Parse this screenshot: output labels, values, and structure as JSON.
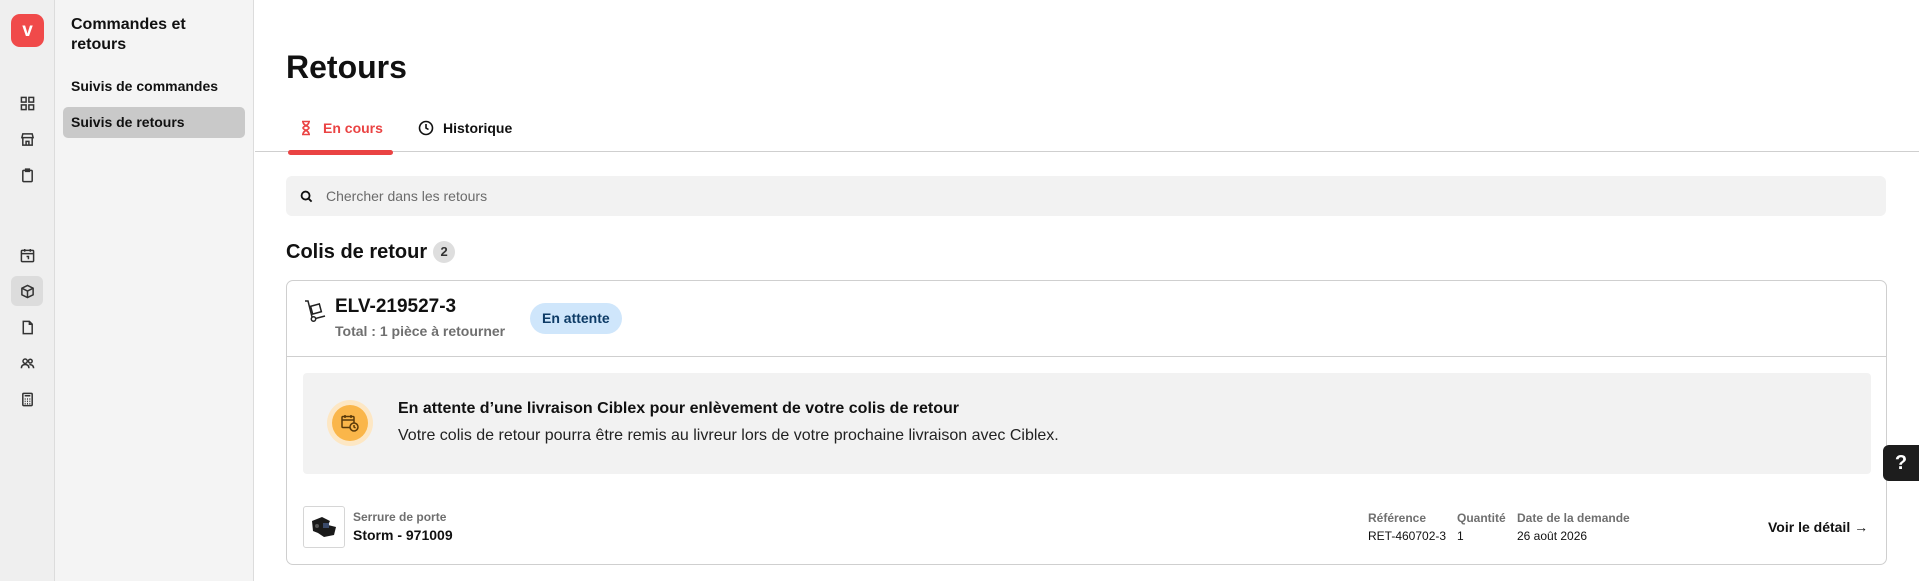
{
  "rail": {
    "logo": "v",
    "icons": [
      "grid-icon",
      "store-icon",
      "clipboard-icon",
      "calendar-icon",
      "package-icon",
      "document-icon",
      "users-icon",
      "calculator-icon"
    ]
  },
  "sidebar": {
    "title": "Commandes et retours",
    "items": [
      {
        "label": "Suivis de commandes"
      },
      {
        "label": "Suivis de retours"
      }
    ]
  },
  "main": {
    "title": "Retours",
    "tabs": [
      {
        "label": "En cours",
        "icon": "hourglass-icon"
      },
      {
        "label": "Historique",
        "icon": "clock-icon"
      }
    ],
    "search": {
      "placeholder": "Chercher dans les retours"
    },
    "section": {
      "title": "Colis de retour",
      "count": "2"
    },
    "card": {
      "id": "ELV-219527-3",
      "subtitle": "Total : 1 pièce à retourner",
      "status": "En attente",
      "notice": {
        "title": "En attente d’une livraison Ciblex pour enlèvement de votre colis de retour",
        "text": "Votre colis de retour pourra être remis au livreur lors de votre prochaine livraison avec Ciblex."
      },
      "product": {
        "category": "Serrure de porte",
        "name": "Storm - 971009"
      },
      "meta": [
        {
          "label": "Référence",
          "value": "RET-460702-3"
        },
        {
          "label": "Quantité",
          "value": "1"
        },
        {
          "label": "Date de la demande",
          "value": "26 août 2026"
        }
      ],
      "detail_link": "Voir le détail →"
    }
  },
  "help": {
    "label": "?"
  },
  "colors": {
    "accent": "#ea4343",
    "status_bg": "#cfe6fb",
    "notice_icon": "#fab64a"
  }
}
